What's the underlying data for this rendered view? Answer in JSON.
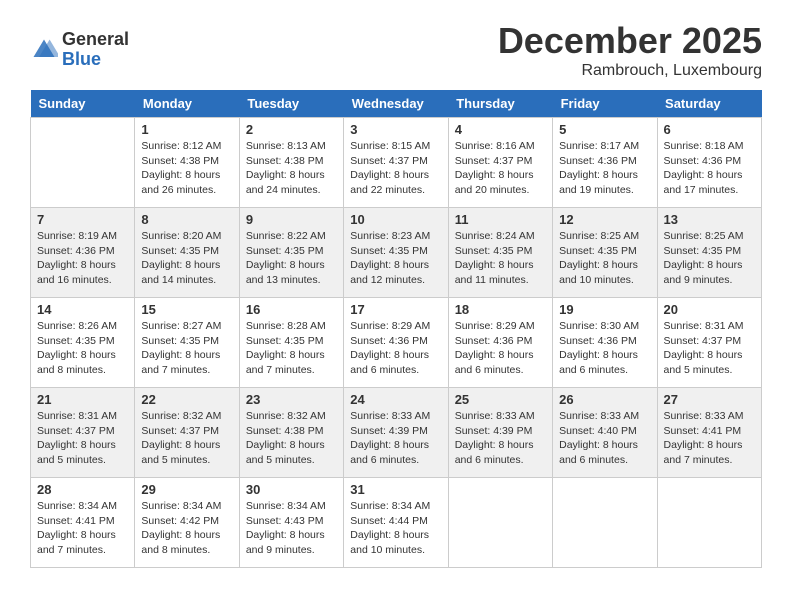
{
  "logo": {
    "general": "General",
    "blue": "Blue"
  },
  "title": {
    "month_year": "December 2025",
    "location": "Rambrouch, Luxembourg"
  },
  "weekdays": [
    "Sunday",
    "Monday",
    "Tuesday",
    "Wednesday",
    "Thursday",
    "Friday",
    "Saturday"
  ],
  "weeks": [
    [
      {
        "day": "",
        "sunrise": "",
        "sunset": "",
        "daylight": ""
      },
      {
        "day": "1",
        "sunrise": "Sunrise: 8:12 AM",
        "sunset": "Sunset: 4:38 PM",
        "daylight": "Daylight: 8 hours and 26 minutes."
      },
      {
        "day": "2",
        "sunrise": "Sunrise: 8:13 AM",
        "sunset": "Sunset: 4:38 PM",
        "daylight": "Daylight: 8 hours and 24 minutes."
      },
      {
        "day": "3",
        "sunrise": "Sunrise: 8:15 AM",
        "sunset": "Sunset: 4:37 PM",
        "daylight": "Daylight: 8 hours and 22 minutes."
      },
      {
        "day": "4",
        "sunrise": "Sunrise: 8:16 AM",
        "sunset": "Sunset: 4:37 PM",
        "daylight": "Daylight: 8 hours and 20 minutes."
      },
      {
        "day": "5",
        "sunrise": "Sunrise: 8:17 AM",
        "sunset": "Sunset: 4:36 PM",
        "daylight": "Daylight: 8 hours and 19 minutes."
      },
      {
        "day": "6",
        "sunrise": "Sunrise: 8:18 AM",
        "sunset": "Sunset: 4:36 PM",
        "daylight": "Daylight: 8 hours and 17 minutes."
      }
    ],
    [
      {
        "day": "7",
        "sunrise": "Sunrise: 8:19 AM",
        "sunset": "Sunset: 4:36 PM",
        "daylight": "Daylight: 8 hours and 16 minutes."
      },
      {
        "day": "8",
        "sunrise": "Sunrise: 8:20 AM",
        "sunset": "Sunset: 4:35 PM",
        "daylight": "Daylight: 8 hours and 14 minutes."
      },
      {
        "day": "9",
        "sunrise": "Sunrise: 8:22 AM",
        "sunset": "Sunset: 4:35 PM",
        "daylight": "Daylight: 8 hours and 13 minutes."
      },
      {
        "day": "10",
        "sunrise": "Sunrise: 8:23 AM",
        "sunset": "Sunset: 4:35 PM",
        "daylight": "Daylight: 8 hours and 12 minutes."
      },
      {
        "day": "11",
        "sunrise": "Sunrise: 8:24 AM",
        "sunset": "Sunset: 4:35 PM",
        "daylight": "Daylight: 8 hours and 11 minutes."
      },
      {
        "day": "12",
        "sunrise": "Sunrise: 8:25 AM",
        "sunset": "Sunset: 4:35 PM",
        "daylight": "Daylight: 8 hours and 10 minutes."
      },
      {
        "day": "13",
        "sunrise": "Sunrise: 8:25 AM",
        "sunset": "Sunset: 4:35 PM",
        "daylight": "Daylight: 8 hours and 9 minutes."
      }
    ],
    [
      {
        "day": "14",
        "sunrise": "Sunrise: 8:26 AM",
        "sunset": "Sunset: 4:35 PM",
        "daylight": "Daylight: 8 hours and 8 minutes."
      },
      {
        "day": "15",
        "sunrise": "Sunrise: 8:27 AM",
        "sunset": "Sunset: 4:35 PM",
        "daylight": "Daylight: 8 hours and 7 minutes."
      },
      {
        "day": "16",
        "sunrise": "Sunrise: 8:28 AM",
        "sunset": "Sunset: 4:35 PM",
        "daylight": "Daylight: 8 hours and 7 minutes."
      },
      {
        "day": "17",
        "sunrise": "Sunrise: 8:29 AM",
        "sunset": "Sunset: 4:36 PM",
        "daylight": "Daylight: 8 hours and 6 minutes."
      },
      {
        "day": "18",
        "sunrise": "Sunrise: 8:29 AM",
        "sunset": "Sunset: 4:36 PM",
        "daylight": "Daylight: 8 hours and 6 minutes."
      },
      {
        "day": "19",
        "sunrise": "Sunrise: 8:30 AM",
        "sunset": "Sunset: 4:36 PM",
        "daylight": "Daylight: 8 hours and 6 minutes."
      },
      {
        "day": "20",
        "sunrise": "Sunrise: 8:31 AM",
        "sunset": "Sunset: 4:37 PM",
        "daylight": "Daylight: 8 hours and 5 minutes."
      }
    ],
    [
      {
        "day": "21",
        "sunrise": "Sunrise: 8:31 AM",
        "sunset": "Sunset: 4:37 PM",
        "daylight": "Daylight: 8 hours and 5 minutes."
      },
      {
        "day": "22",
        "sunrise": "Sunrise: 8:32 AM",
        "sunset": "Sunset: 4:37 PM",
        "daylight": "Daylight: 8 hours and 5 minutes."
      },
      {
        "day": "23",
        "sunrise": "Sunrise: 8:32 AM",
        "sunset": "Sunset: 4:38 PM",
        "daylight": "Daylight: 8 hours and 5 minutes."
      },
      {
        "day": "24",
        "sunrise": "Sunrise: 8:33 AM",
        "sunset": "Sunset: 4:39 PM",
        "daylight": "Daylight: 8 hours and 6 minutes."
      },
      {
        "day": "25",
        "sunrise": "Sunrise: 8:33 AM",
        "sunset": "Sunset: 4:39 PM",
        "daylight": "Daylight: 8 hours and 6 minutes."
      },
      {
        "day": "26",
        "sunrise": "Sunrise: 8:33 AM",
        "sunset": "Sunset: 4:40 PM",
        "daylight": "Daylight: 8 hours and 6 minutes."
      },
      {
        "day": "27",
        "sunrise": "Sunrise: 8:33 AM",
        "sunset": "Sunset: 4:41 PM",
        "daylight": "Daylight: 8 hours and 7 minutes."
      }
    ],
    [
      {
        "day": "28",
        "sunrise": "Sunrise: 8:34 AM",
        "sunset": "Sunset: 4:41 PM",
        "daylight": "Daylight: 8 hours and 7 minutes."
      },
      {
        "day": "29",
        "sunrise": "Sunrise: 8:34 AM",
        "sunset": "Sunset: 4:42 PM",
        "daylight": "Daylight: 8 hours and 8 minutes."
      },
      {
        "day": "30",
        "sunrise": "Sunrise: 8:34 AM",
        "sunset": "Sunset: 4:43 PM",
        "daylight": "Daylight: 8 hours and 9 minutes."
      },
      {
        "day": "31",
        "sunrise": "Sunrise: 8:34 AM",
        "sunset": "Sunset: 4:44 PM",
        "daylight": "Daylight: 8 hours and 10 minutes."
      },
      {
        "day": "",
        "sunrise": "",
        "sunset": "",
        "daylight": ""
      },
      {
        "day": "",
        "sunrise": "",
        "sunset": "",
        "daylight": ""
      },
      {
        "day": "",
        "sunrise": "",
        "sunset": "",
        "daylight": ""
      }
    ]
  ]
}
